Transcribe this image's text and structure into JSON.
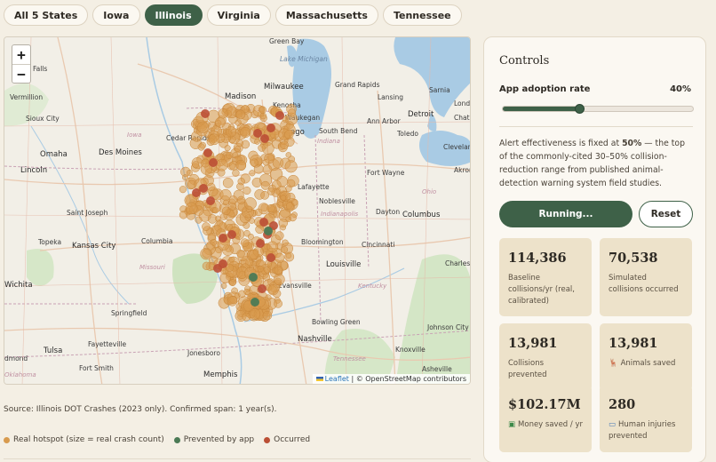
{
  "tabs": [
    {
      "label": "All 5 States",
      "active": false
    },
    {
      "label": "Iowa",
      "active": false
    },
    {
      "label": "Illinois",
      "active": true
    },
    {
      "label": "Virginia",
      "active": false
    },
    {
      "label": "Massachusetts",
      "active": false
    },
    {
      "label": "Tennessee",
      "active": false
    }
  ],
  "map": {
    "zoom_in": "+",
    "zoom_out": "−",
    "attribution_leaflet": "Leaflet",
    "attribution_rest": " | © OpenStreetMap contributors",
    "labels": {
      "green_bay": "Green Bay",
      "lake_michigan": "Lake Michigan",
      "milwaukee": "Milwaukee",
      "grand_rapids": "Grand Rapids",
      "lansing": "Lansing",
      "sarnia": "Sarnia",
      "madison": "Madison",
      "kenosha": "Kenosha",
      "waukegan": "Waukegan",
      "ago": "ago",
      "detroit": "Detroit",
      "london": "Londo",
      "chatham": "Chatham",
      "south_bend": "South Bend",
      "ann_arbor": "Ann Arbor",
      "toledo": "Toledo",
      "cleveland": "Cleveland",
      "falls": "Falls",
      "vermillion": "Vermillion",
      "sioux_city": "Sioux City",
      "iowa": "Iowa",
      "cedar_rapids": "Cedar Rapids",
      "omaha": "Omaha",
      "des_moines": "Des Moines",
      "indiana": "Indiana",
      "fort_wayne": "Fort Wayne",
      "ohio": "Ohio",
      "lincoln": "Lincoln",
      "lafayette": "Lafayette",
      "noblesville": "Noblesville",
      "indianapolis": "Indianapolis",
      "dayton": "Dayton",
      "columbus": "Columbus",
      "akron": "Akron",
      "saint_joseph": "Saint Joseph",
      "topeka": "Topeka",
      "kansas_city": "Kansas City",
      "columbia": "Columbia",
      "bloomington": "Bloomington",
      "cincinnati": "Cincinnati",
      "charleston": "Charlesto",
      "missouri": "Missouri",
      "louisville": "Louisville",
      "wichita": "Wichita",
      "evansville": "Evansville",
      "kentucky": "Kentucky",
      "springfield": "Springfield",
      "bowling_green": "Bowling Green",
      "johnson_city": "Johnson City",
      "nashville": "Nashville",
      "tulsa": "Tulsa",
      "fayetteville": "Fayetteville",
      "jonesboro": "Jonesboro",
      "fort_smith": "Fort Smith",
      "knoxville": "Knoxville",
      "asheville": "Asheville",
      "memphis": "Memphis",
      "oklahoma": "Oklahoma",
      "dmond": "dmond",
      "tennessee": "Tennessee"
    }
  },
  "source_text": "Source: Illinois DOT Crashes (2023 only). Confirmed span: 1 year(s).",
  "legend": {
    "hotspot": "Real hotspot (size = real crash count)",
    "prevented": "Prevented by app",
    "occurred": "Occurred"
  },
  "colors": {
    "accent": "#3e6148",
    "hotspot": "#d89b4e",
    "prevented": "#4b7a55",
    "occurred": "#bb4f35",
    "card_bg": "#ede2ca"
  },
  "controls": {
    "title": "Controls",
    "adoption_label": "App adoption rate",
    "adoption_value": "40%",
    "adoption_fraction": 0.4,
    "note_pre": "Alert effectiveness is fixed at ",
    "note_bold": "50%",
    "note_post": " — the top of the commonly-cited 30–50% collision-reduction range from published animal-detection warning system field studies.",
    "run_label": "Running...",
    "reset_label": "Reset"
  },
  "stats": {
    "baseline": {
      "value": "114,386",
      "label": "Baseline collisions/yr (real, calibrated)"
    },
    "simulated": {
      "value": "70,538",
      "label": "Simulated collisions occurred"
    },
    "prevented": {
      "value": "13,981",
      "label": "Collisions prevented"
    },
    "animals": {
      "value": "13,981",
      "label": "Animals saved",
      "icon": "deer-icon"
    },
    "money": {
      "value": "$102.17M",
      "label": "Money saved / yr",
      "icon": "money-icon"
    },
    "injuries": {
      "value": "280",
      "label": "Human injuries prevented",
      "icon": "bandage-icon"
    }
  }
}
